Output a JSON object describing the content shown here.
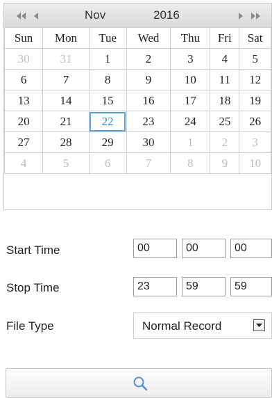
{
  "calendar": {
    "month": "Nov",
    "year": "2016",
    "weekdays": [
      "Sun",
      "Mon",
      "Tue",
      "Wed",
      "Thu",
      "Fri",
      "Sat"
    ],
    "weeks": [
      [
        {
          "d": "30",
          "o": true
        },
        {
          "d": "31",
          "o": true
        },
        {
          "d": "1"
        },
        {
          "d": "2"
        },
        {
          "d": "3"
        },
        {
          "d": "4"
        },
        {
          "d": "5"
        }
      ],
      [
        {
          "d": "6"
        },
        {
          "d": "7"
        },
        {
          "d": "8"
        },
        {
          "d": "9"
        },
        {
          "d": "10"
        },
        {
          "d": "11"
        },
        {
          "d": "12"
        }
      ],
      [
        {
          "d": "13"
        },
        {
          "d": "14"
        },
        {
          "d": "15"
        },
        {
          "d": "16"
        },
        {
          "d": "17"
        },
        {
          "d": "18"
        },
        {
          "d": "19"
        }
      ],
      [
        {
          "d": "20"
        },
        {
          "d": "21"
        },
        {
          "d": "22",
          "selected": true
        },
        {
          "d": "23"
        },
        {
          "d": "24"
        },
        {
          "d": "25"
        },
        {
          "d": "26"
        }
      ],
      [
        {
          "d": "27"
        },
        {
          "d": "28"
        },
        {
          "d": "29"
        },
        {
          "d": "30"
        },
        {
          "d": "1",
          "o": true
        },
        {
          "d": "2",
          "o": true
        },
        {
          "d": "3",
          "o": true
        }
      ],
      [
        {
          "d": "4",
          "o": true
        },
        {
          "d": "5",
          "o": true
        },
        {
          "d": "6",
          "o": true
        },
        {
          "d": "7",
          "o": true
        },
        {
          "d": "8",
          "o": true
        },
        {
          "d": "9",
          "o": true
        },
        {
          "d": "10",
          "o": true
        }
      ]
    ],
    "selected_color": "#2e8ad8"
  },
  "start_time": {
    "label": "Start Time",
    "hour": "00",
    "minute": "00",
    "second": "00"
  },
  "stop_time": {
    "label": "Stop Time",
    "hour": "23",
    "minute": "59",
    "second": "59"
  },
  "file_type": {
    "label": "File Type",
    "value": "Normal Record"
  },
  "search": {
    "icon": "search-icon"
  }
}
